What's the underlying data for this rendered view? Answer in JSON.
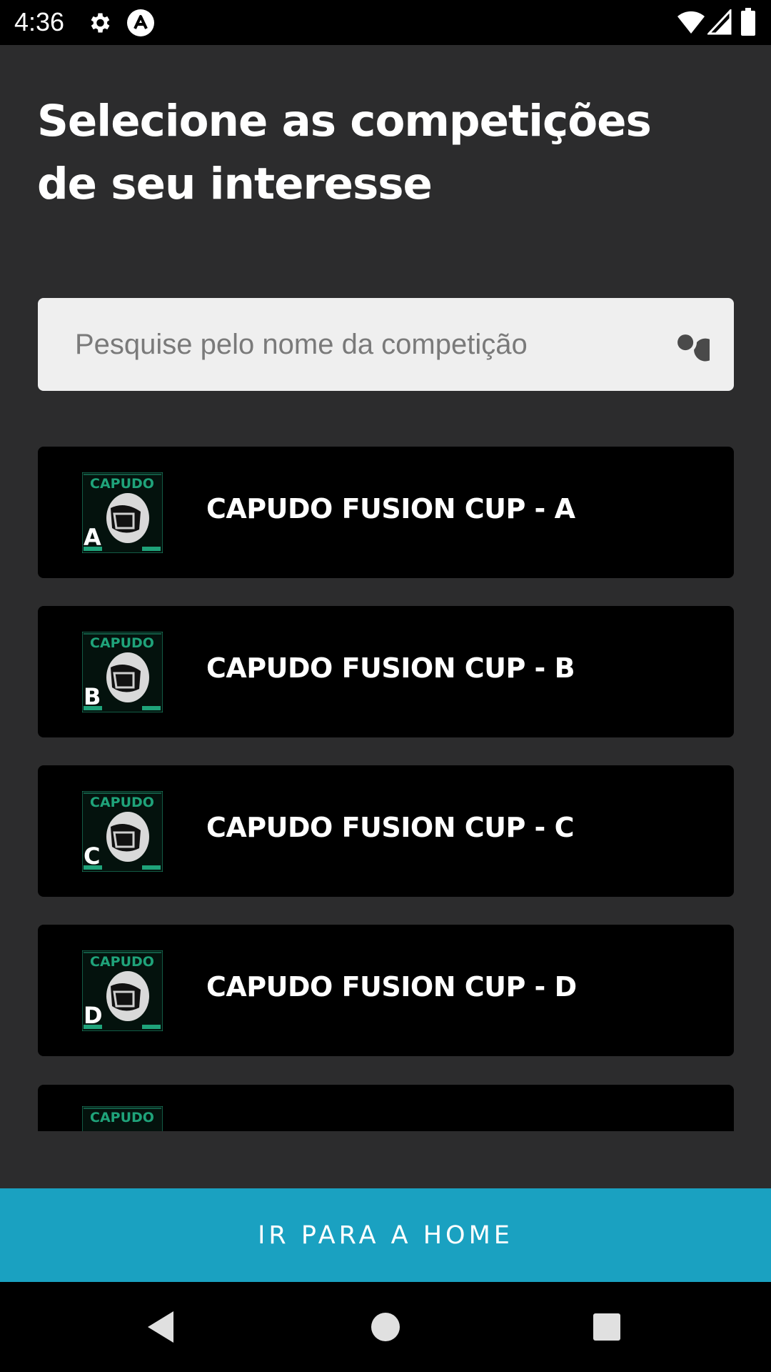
{
  "status_bar": {
    "time": "4:36",
    "icons": [
      "gear-icon",
      "app-notification-icon",
      "wifi-icon",
      "signal-icon",
      "battery-icon"
    ]
  },
  "page": {
    "title_line1": "Selecione as competições",
    "title_line2": "de seu interesse"
  },
  "search": {
    "placeholder": "Pesquise pelo nome da competição",
    "value": "",
    "icon": "search-icon"
  },
  "competitions": [
    {
      "name": "CAPUDO FUSION CUP - A",
      "badge_letter": "A",
      "logo_text": "CAPUDO"
    },
    {
      "name": "CAPUDO FUSION CUP - B",
      "badge_letter": "B",
      "logo_text": "CAPUDO"
    },
    {
      "name": "CAPUDO FUSION CUP - C",
      "badge_letter": "C",
      "logo_text": "CAPUDO"
    },
    {
      "name": "CAPUDO FUSION CUP - D",
      "badge_letter": "D",
      "logo_text": "CAPUDO"
    },
    {
      "name": "",
      "badge_letter": "",
      "logo_text": "CAPUDO"
    }
  ],
  "actions": {
    "home_button_label": "IR PARA A HOME"
  },
  "navigation": {
    "buttons": [
      "back-icon",
      "home-icon",
      "recents-icon"
    ]
  },
  "colors": {
    "background": "#2c2c2d",
    "card": "#000000",
    "accent": "#1aa1c1",
    "logo_green": "#1fa37a",
    "search_bg": "#efefef"
  }
}
